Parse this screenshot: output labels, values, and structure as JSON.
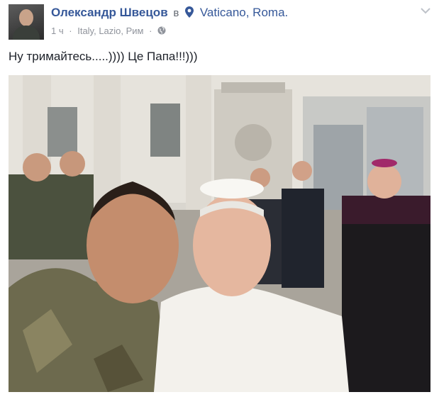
{
  "post": {
    "author_name": "Олександр Швецов",
    "in_word": "в",
    "location": "Vaticano, Roma.",
    "time": "1 ч",
    "place_detail": "Italy, Lazio, Рим",
    "separator": "·",
    "text": "Ну тримайтесь.....)))) Це Папа!!!)))"
  },
  "icons": {
    "location": "map-pin-icon",
    "privacy": "globe-icon",
    "options": "chevron-down-icon"
  },
  "colors": {
    "link": "#365899",
    "meta": "#90949c",
    "text": "#1d2129"
  }
}
